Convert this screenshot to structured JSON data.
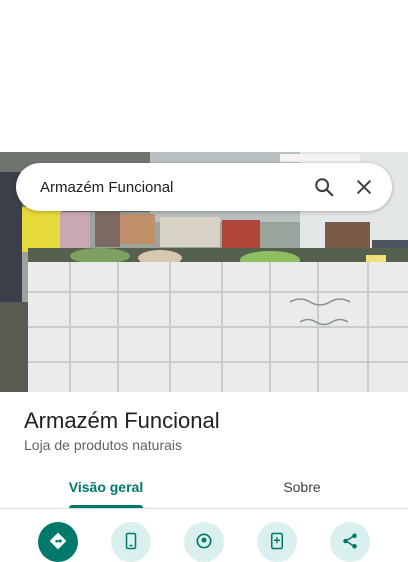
{
  "search": {
    "query": "Armazém Funcional"
  },
  "place": {
    "name": "Armazém Funcional",
    "category": "Loja de produtos naturais"
  },
  "tabs": [
    {
      "label": "Visão geral",
      "selected": true
    },
    {
      "label": "Sobre",
      "selected": false
    }
  ],
  "actions": [
    {
      "icon": "directions-icon"
    },
    {
      "icon": "phone-icon"
    },
    {
      "icon": "location-icon"
    },
    {
      "icon": "add-phone-icon"
    },
    {
      "icon": "share-icon"
    }
  ],
  "colors": {
    "accent": "#00796b",
    "accent_light": "#d9f0ee",
    "text_primary": "#202124",
    "text_secondary": "#5f6368"
  }
}
